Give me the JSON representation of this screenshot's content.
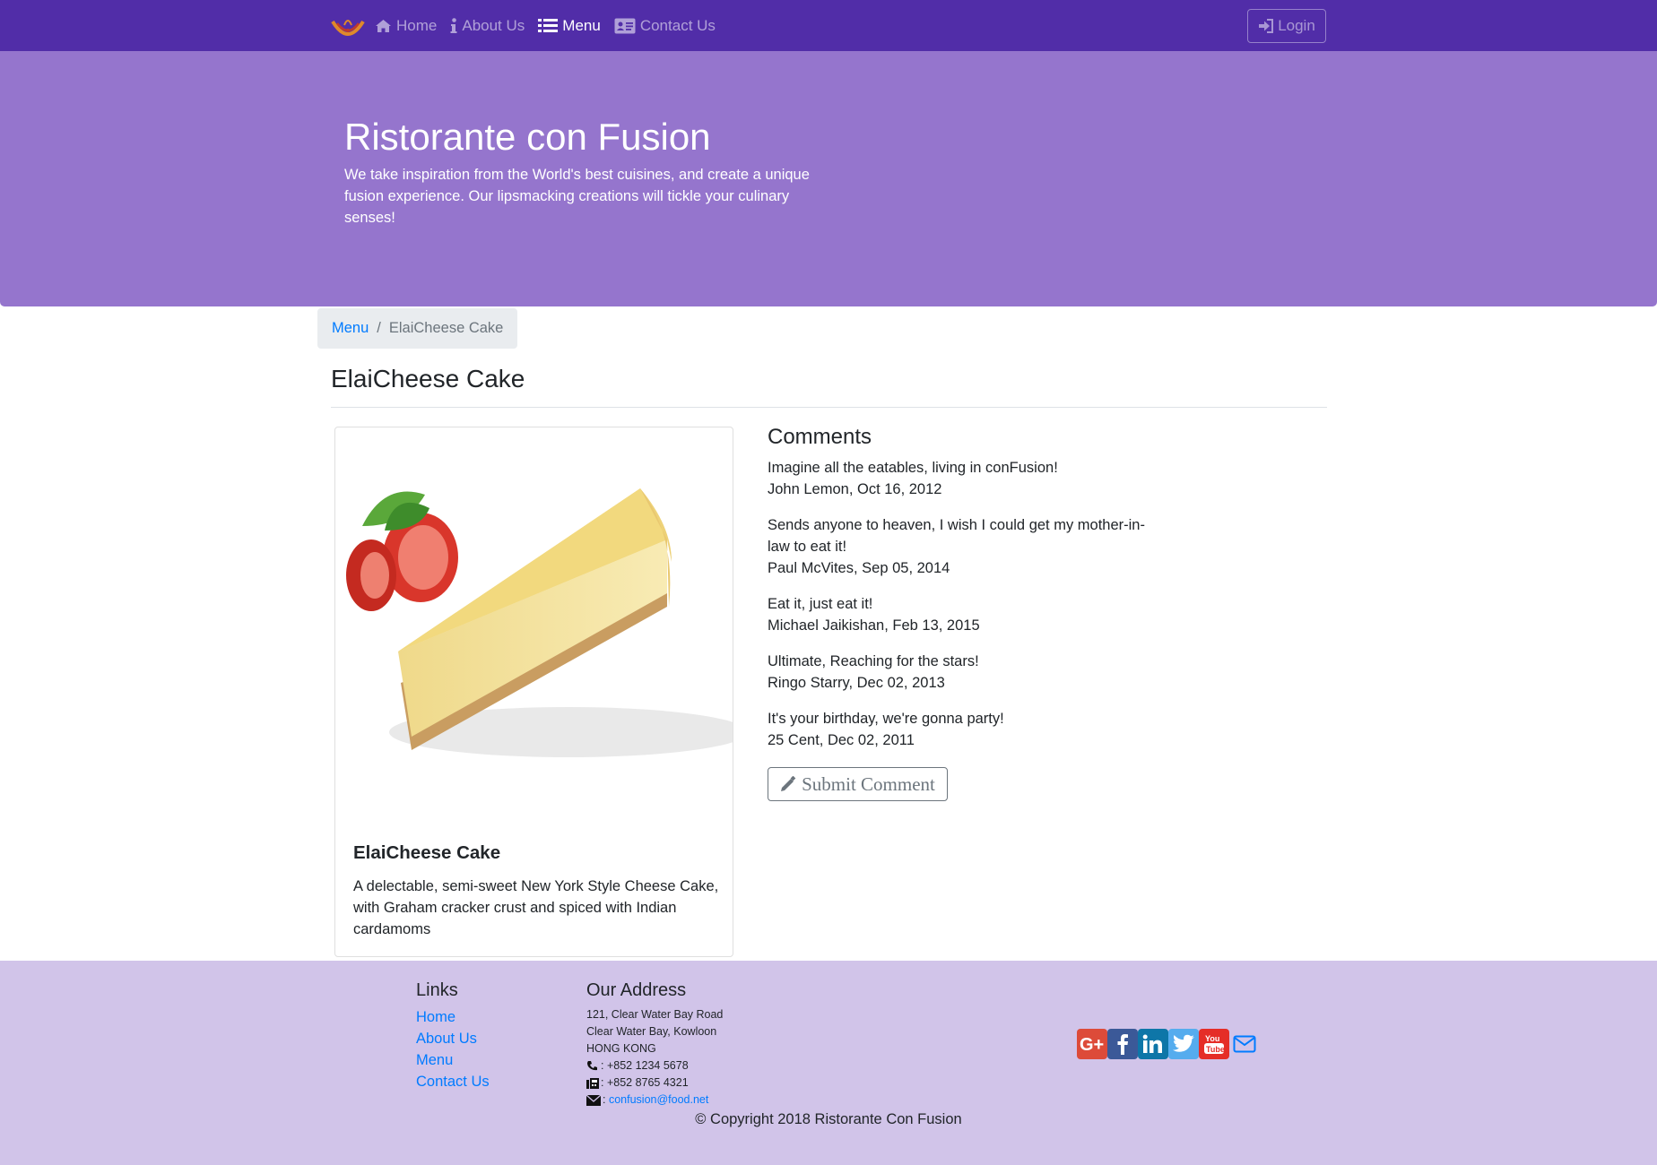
{
  "navbar": {
    "logo_icon": "restaurant-logo",
    "items": [
      {
        "label": "Home",
        "icon": "home-icon"
      },
      {
        "label": "About Us",
        "icon": "info-icon"
      },
      {
        "label": "Menu",
        "icon": "list-icon",
        "active": true
      },
      {
        "label": "Contact Us",
        "icon": "address-card-icon"
      }
    ],
    "login_label": "Login",
    "bg_color": "#512da8"
  },
  "jumbotron": {
    "title": "Ristorante con Fusion",
    "text": "We take inspiration from the World's best cuisines, and create a unique fusion experience. Our lipsmacking creations will tickle your culinary senses!",
    "bg_color": "#9575cd"
  },
  "breadcrumb": {
    "items": [
      "Menu",
      "ElaiCheese Cake"
    ]
  },
  "page_title": "ElaiCheese Cake",
  "dish": {
    "name": "ElaiCheese Cake",
    "description": "A delectable, semi-sweet New York Style Cheese Cake, with Graham cracker crust and spiced with Indian cardamoms"
  },
  "comments": {
    "heading": "Comments",
    "items": [
      {
        "text": "Imagine all the eatables, living in conFusion!",
        "meta": "John Lemon, Oct 16, 2012"
      },
      {
        "text": "Sends anyone to heaven, I wish I could get my mother-in-law to eat it!",
        "meta": "Paul McVites, Sep 05, 2014"
      },
      {
        "text": "Eat it, just eat it!",
        "meta": "Michael Jaikishan, Feb 13, 2015"
      },
      {
        "text": "Ultimate, Reaching for the stars!",
        "meta": "Ringo Starry, Dec 02, 2013"
      },
      {
        "text": "It's your birthday, we're gonna party!",
        "meta": "25 Cent, Dec 02, 2011"
      }
    ],
    "submit_label": "Submit Comment"
  },
  "footer": {
    "links_heading": "Links",
    "links": [
      "Home",
      "About Us",
      "Menu",
      "Contact Us"
    ],
    "address_heading": "Our Address",
    "address_lines": [
      "121, Clear Water Bay Road",
      "Clear Water Bay, Kowloon",
      "HONG KONG"
    ],
    "phone": ": +852 1234 5678",
    "fax": ": +852 8765 4321",
    "email_prefix": ":",
    "email": "confusion@food.net",
    "social": [
      "google-plus-icon",
      "facebook-icon",
      "linkedin-icon",
      "twitter-icon",
      "youtube-icon",
      "envelope-icon"
    ],
    "copyright": "© Copyright 2018 Ristorante Con Fusion",
    "bg_color": "#d1c4e9"
  }
}
